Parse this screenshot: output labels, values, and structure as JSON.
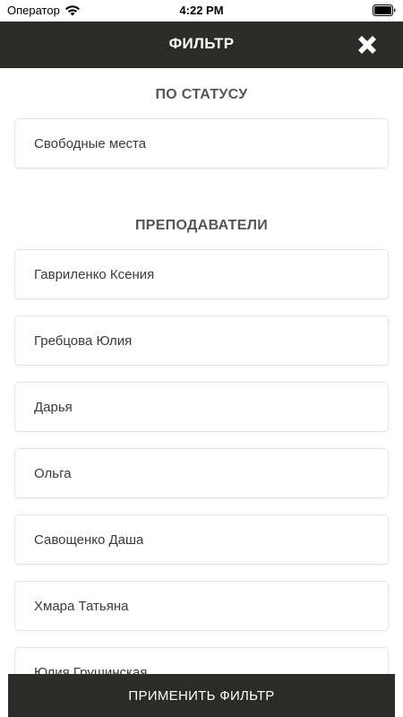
{
  "status_bar": {
    "carrier": "Оператор",
    "time": "4:22 PM",
    "wifi_icon": "wifi-icon",
    "battery_icon": "battery-icon"
  },
  "header": {
    "title": "ФИЛЬТР",
    "close_icon": "close-icon",
    "background": "#2b2b28"
  },
  "status_section": {
    "title": "ПО СТАТУСУ",
    "items": [
      {
        "label": "Свободные места"
      }
    ]
  },
  "teachers_section": {
    "title": "ПРЕПОДАВАТЕЛИ",
    "items": [
      {
        "label": "Гавриленко Ксения"
      },
      {
        "label": "Гребцова Юлия"
      },
      {
        "label": "Дарья"
      },
      {
        "label": "Ольга"
      },
      {
        "label": "Савощенко Даша"
      },
      {
        "label": "Хмара Татьяна"
      },
      {
        "label": "Юлия Грушинская"
      }
    ]
  },
  "apply_button": {
    "label": "ПРИМЕНИТЬ ФИЛЬТР"
  }
}
